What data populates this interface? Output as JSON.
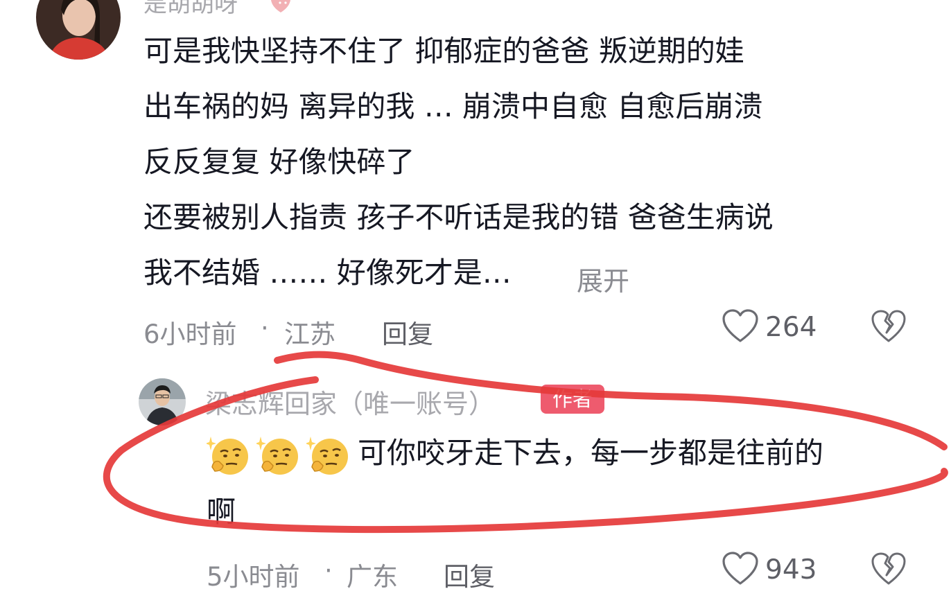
{
  "comment1": {
    "avatar": "user-avatar-photo",
    "username": "是胡胡呀",
    "username_emoji": "strawberry-icon",
    "text_lines": [
      "可是我快坚持不住了  抑郁症的爸爸  叛逆期的娃",
      "出车祸的妈  离异的我  … 崩溃中自愈  自愈后崩溃",
      "反反复复  好像快碎了",
      "还要被别人指责  孩子不听话是我的错  爸爸生病说",
      "我不结婚 …… 好像死才是…"
    ],
    "expand_label": "展开",
    "time": "6小时前",
    "separator": "·",
    "location": "江苏",
    "reply_label": "回复",
    "like_count": "264",
    "like_icon": "heart-outline-icon",
    "dislike_icon": "broken-heart-icon"
  },
  "comment2": {
    "avatar": "author-avatar-photo",
    "username": "梁志辉回家（唯一账号）",
    "author_badge": "作者",
    "emojis": [
      "thinking-face-emoji",
      "thinking-face-emoji",
      "thinking-face-emoji"
    ],
    "text_line1": "可你咬牙走下去，每一步都是往前的",
    "text_line2": "啊",
    "time": "5小时前",
    "separator": "·",
    "location": "广东",
    "reply_label": "回复",
    "like_count": "943",
    "like_icon": "heart-outline-icon",
    "dislike_icon": "broken-heart-icon"
  },
  "colors": {
    "annotation_red": "#e53a3a",
    "author_badge_bg": "#ee5b6e",
    "text_primary": "#161823",
    "text_secondary": "#8a8b91"
  },
  "annotation": "red-hand-drawn-ellipse"
}
